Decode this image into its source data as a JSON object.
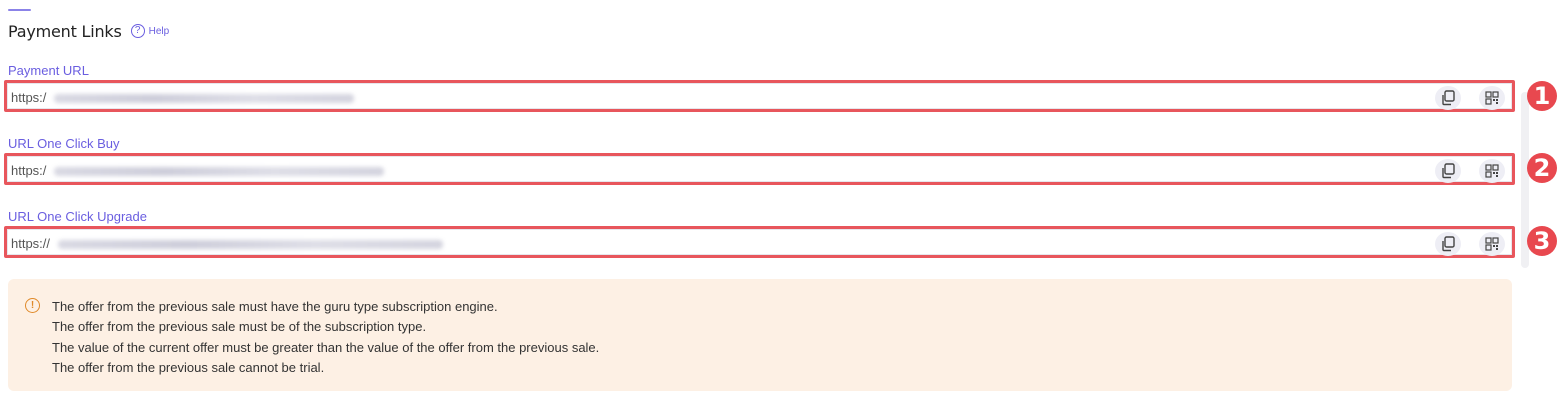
{
  "section": {
    "title": "Payment Links",
    "help_label": "Help"
  },
  "fields": [
    {
      "label": "Payment URL",
      "value_prefix": "https:/",
      "annotation": "1"
    },
    {
      "label": "URL One Click Buy",
      "value_prefix": "https:/",
      "annotation": "2"
    },
    {
      "label": "URL One Click Upgrade",
      "value_prefix": "https://",
      "annotation": "3"
    }
  ],
  "field_icons": {
    "copy": "copy-icon",
    "qr": "qr-code-icon"
  },
  "notice": {
    "icon": "warning-circle-icon",
    "lines": [
      "The offer from the previous sale must have the guru type subscription engine.",
      "The offer from the previous sale must be of the subscription type.",
      "The value of the current offer must be greater than the value of the offer from the previous sale.",
      "The offer from the previous sale cannot be trial."
    ]
  },
  "colors": {
    "accent": "#6a5ee0",
    "highlight": "#e8565c",
    "notice_bg": "#fdf0e4",
    "notice_icon": "#e08a2a"
  }
}
